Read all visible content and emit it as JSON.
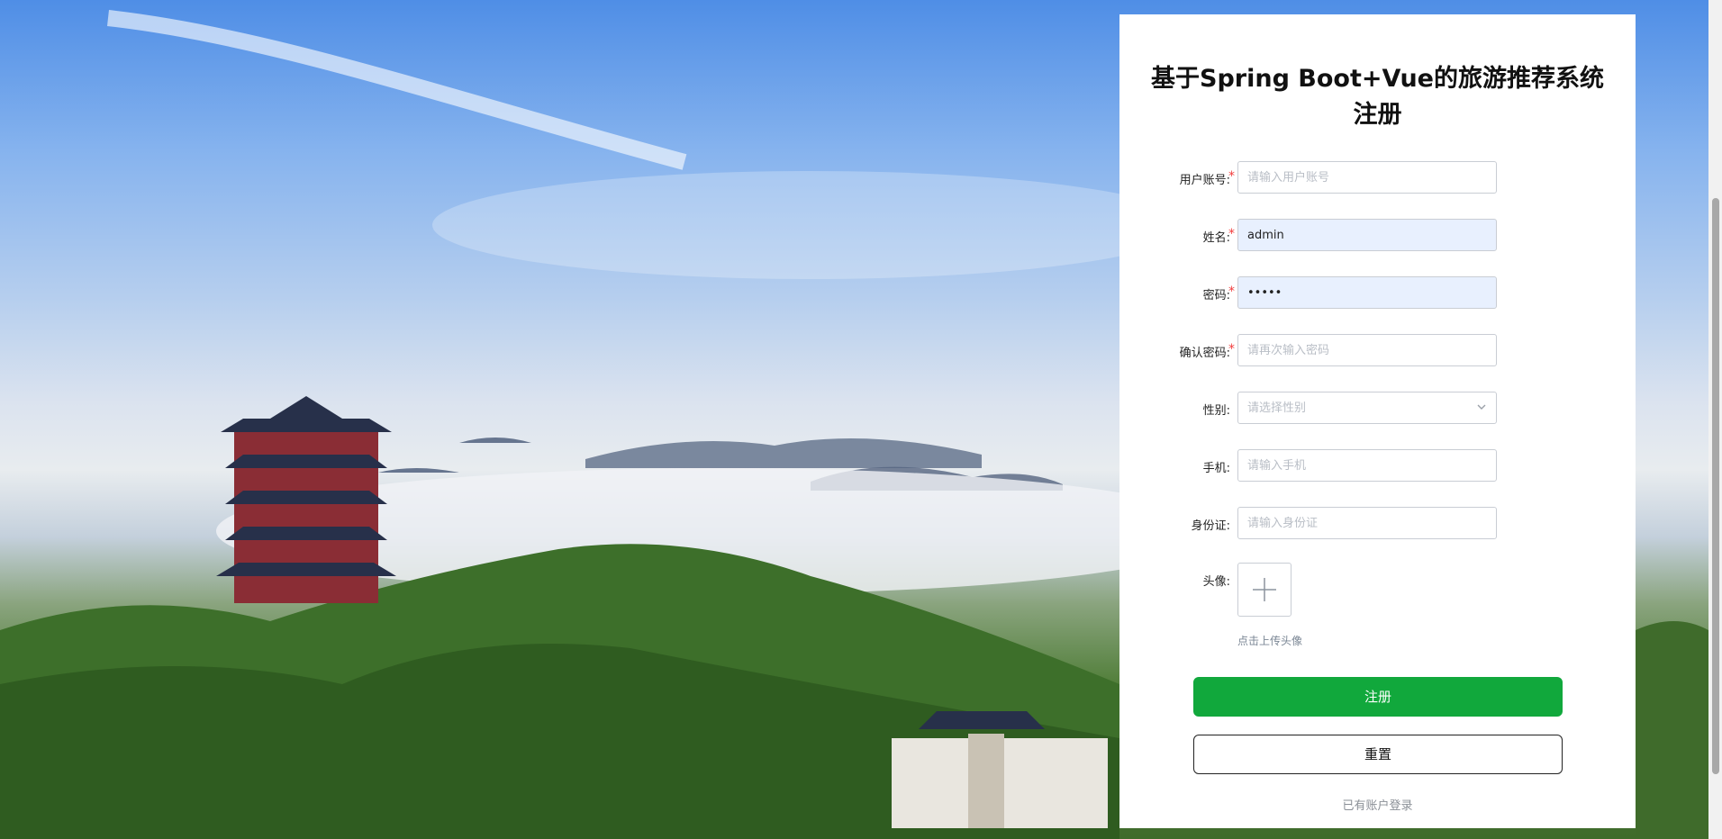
{
  "page": {
    "title_line1": "基于Spring Boot+Vue的旅游推荐系统",
    "title_line2": "注册"
  },
  "form": {
    "username": {
      "label": "用户账号:",
      "required": true,
      "placeholder": "请输入用户账号",
      "value": ""
    },
    "name": {
      "label": "姓名:",
      "required": true,
      "placeholder": "",
      "value": "admin"
    },
    "password": {
      "label": "密码:",
      "required": true,
      "placeholder": "",
      "value": "•••••"
    },
    "confirm_password": {
      "label": "确认密码:",
      "required": true,
      "placeholder": "请再次输入密码",
      "value": ""
    },
    "gender": {
      "label": "性别:",
      "required": false,
      "placeholder": "请选择性别",
      "value": ""
    },
    "phone": {
      "label": "手机:",
      "required": false,
      "placeholder": "请输入手机",
      "value": ""
    },
    "id_card": {
      "label": "身份证:",
      "required": false,
      "placeholder": "请输入身份证",
      "value": ""
    },
    "avatar": {
      "label": "头像:",
      "hint": "点击上传头像"
    },
    "required_mark": "*"
  },
  "actions": {
    "register_label": "注册",
    "reset_label": "重置",
    "login_link": "已有账户登录"
  },
  "icons": {
    "select": "chevron-down-icon",
    "upload": "plus-icon"
  },
  "colors": {
    "primary": "#11a83c",
    "required": "#f23c3c",
    "autofill_bg": "#e8f0fe"
  }
}
